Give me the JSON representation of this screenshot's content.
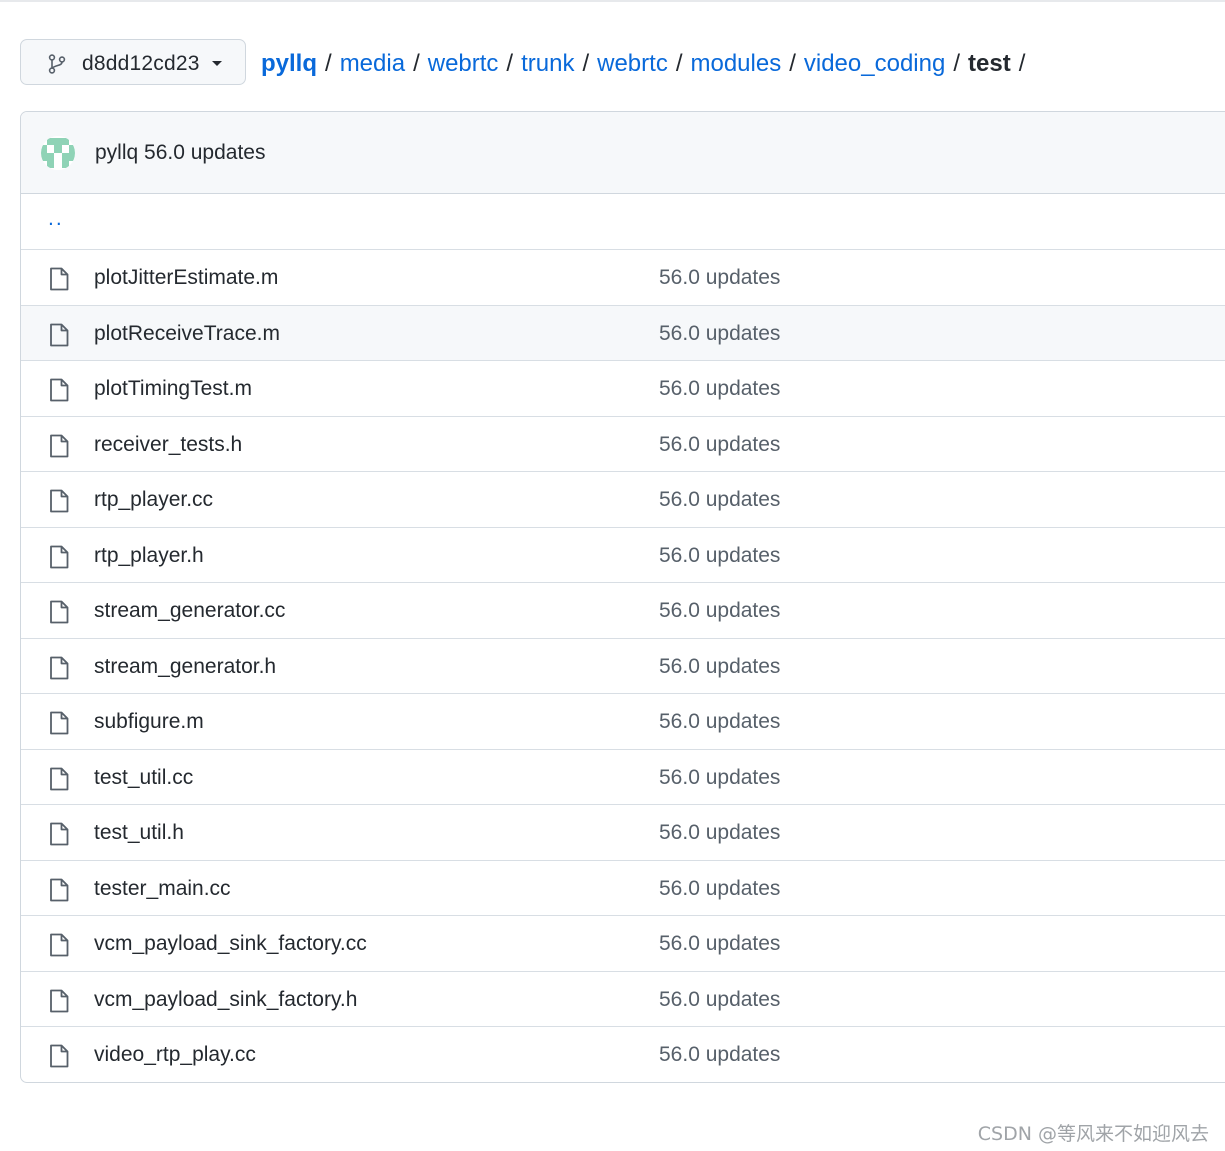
{
  "branch": {
    "name": "d8dd12cd23",
    "icon": "git-branch-icon"
  },
  "breadcrumb": {
    "root": "pyllq",
    "segments": [
      "media",
      "webrtc",
      "trunk",
      "webrtc",
      "modules",
      "video_coding"
    ],
    "current": "test",
    "separator": "/"
  },
  "latest_commit": {
    "author": "pyllq",
    "message": "56.0 updates"
  },
  "parent_link": "..",
  "files": [
    {
      "name": "plotJitterEstimate.m",
      "commit": "56.0 updates"
    },
    {
      "name": "plotReceiveTrace.m",
      "commit": "56.0 updates"
    },
    {
      "name": "plotTimingTest.m",
      "commit": "56.0 updates"
    },
    {
      "name": "receiver_tests.h",
      "commit": "56.0 updates"
    },
    {
      "name": "rtp_player.cc",
      "commit": "56.0 updates"
    },
    {
      "name": "rtp_player.h",
      "commit": "56.0 updates"
    },
    {
      "name": "stream_generator.cc",
      "commit": "56.0 updates"
    },
    {
      "name": "stream_generator.h",
      "commit": "56.0 updates"
    },
    {
      "name": "subfigure.m",
      "commit": "56.0 updates"
    },
    {
      "name": "test_util.cc",
      "commit": "56.0 updates"
    },
    {
      "name": "test_util.h",
      "commit": "56.0 updates"
    },
    {
      "name": "tester_main.cc",
      "commit": "56.0 updates"
    },
    {
      "name": "vcm_payload_sink_factory.cc",
      "commit": "56.0 updates"
    },
    {
      "name": "vcm_payload_sink_factory.h",
      "commit": "56.0 updates"
    },
    {
      "name": "video_rtp_play.cc",
      "commit": "56.0 updates"
    }
  ],
  "watermark": "CSDN @等风来不如迎风去",
  "colors": {
    "link": "#0969da",
    "text": "#24292f",
    "muted": "#57606a",
    "border": "#d0d7de",
    "header_bg": "#f6f8fa",
    "avatar": "#8fd3b6"
  }
}
